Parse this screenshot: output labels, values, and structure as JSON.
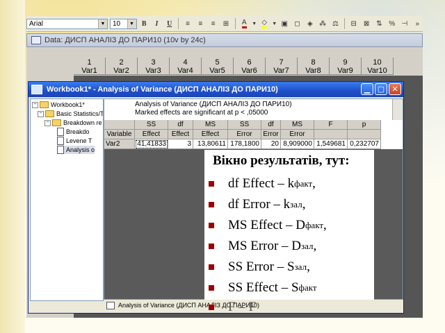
{
  "toolbar": {
    "font_name": "Arial",
    "font_size": "10",
    "icons": [
      "bold-icon",
      "italic-icon",
      "underline-icon",
      "align-left-icon",
      "align-center-icon",
      "align-right-icon",
      "merge-icon",
      "font-color-icon",
      "fill-color-icon",
      "cell-icon",
      "shape-icon",
      "link-icon",
      "random-icon",
      "weight-icon",
      "table-icon",
      "column-icon",
      "sort-icon",
      "percent-icon",
      "variable-icon"
    ]
  },
  "data_window": {
    "title": "Data: ДИСП АНАЛІЗ ДО ПАРИ10 (10v by 24c)",
    "columns": [
      {
        "num": "1",
        "name": "Var1"
      },
      {
        "num": "2",
        "name": "Var2"
      },
      {
        "num": "3",
        "name": "Var3"
      },
      {
        "num": "4",
        "name": "Var4"
      },
      {
        "num": "5",
        "name": "Var5"
      },
      {
        "num": "6",
        "name": "Var6"
      },
      {
        "num": "7",
        "name": "Var7"
      },
      {
        "num": "8",
        "name": "Var8"
      },
      {
        "num": "9",
        "name": "Var9"
      },
      {
        "num": "10",
        "name": "Var10"
      }
    ]
  },
  "workbook": {
    "title": "Workbook1* - Analysis of Variance (ДИСП АНАЛІЗ ДО ПАРИ10)",
    "tree": [
      "Workbook1*",
      "Basic Statistics/Ta",
      "Breakdown re",
      "Breakdo",
      "Levene T",
      "Analysis o"
    ],
    "results": {
      "line1": "Analysis of Variance (ДИСП АНАЛІЗ ДО ПАРИ10)",
      "line2": "Marked effects are significant at p < ,05000",
      "headers": [
        {
          "top": "",
          "bottom": "Variable"
        },
        {
          "top": "SS",
          "bottom": "Effect"
        },
        {
          "top": "df",
          "bottom": "Effect"
        },
        {
          "top": "MS",
          "bottom": "Effect"
        },
        {
          "top": "SS",
          "bottom": "Error"
        },
        {
          "top": "df",
          "bottom": "Error"
        },
        {
          "top": "MS",
          "bottom": "Error"
        },
        {
          "top": "F",
          "bottom": ""
        },
        {
          "top": "p",
          "bottom": ""
        }
      ],
      "row": [
        "Var2",
        "41,41833",
        "3",
        "13,80611",
        "178,1800",
        "20",
        "8,909000",
        "1,549681",
        "0,232707"
      ]
    },
    "status_tab": "Analysis of Variance (ДИСП АНАЛІЗ ДО ПАРИ10)"
  },
  "overlay": {
    "title": "Вікно результатів, тут:",
    "items": [
      {
        "text": "df Effect – k",
        "sub": "факт",
        "tail": ","
      },
      {
        "text": "df Error – k",
        "sub": "зал",
        "tail": ","
      },
      {
        "text": "MS Effect – D",
        "sub": "факт",
        "tail": ","
      },
      {
        "text": "MS Error – D",
        "sub": "зал",
        "tail": ","
      },
      {
        "text": "SS Error – S",
        "sub": "зал",
        "tail": ","
      },
      {
        "text": "SS Effect – S",
        "sub": "факт",
        "tail": ""
      }
    ],
    "trailing": "F – F"
  },
  "colors": {
    "title_bar": "#1f4fc8",
    "bullet": "#9b0000",
    "grid_fill": "#5a5a5a"
  }
}
